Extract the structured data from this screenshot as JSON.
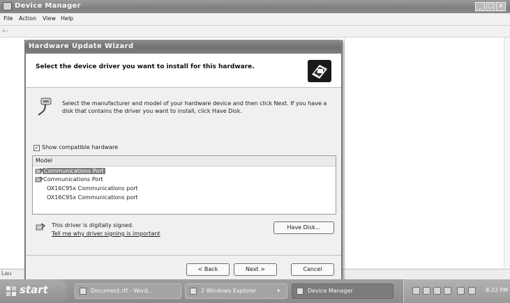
{
  "device_manager": {
    "title": "Device Manager",
    "menu": {
      "file": "File",
      "action": "Action",
      "view": "View",
      "help": "Help"
    },
    "status_text": "Lau"
  },
  "wizard": {
    "title": "Hardware Update Wizard",
    "heading": "Select the device driver you want to install for this hardware.",
    "instructions": "Select the manufacturer and model of your hardware device and then click Next. If you have a disk that contains the driver you want to install, click Have Disk.",
    "show_compatible": {
      "label": "Show compatible hardware",
      "checked": true,
      "mark": "✓"
    },
    "model_list": {
      "header": "Model",
      "items": [
        "Communications Port",
        "Communications Port",
        "OX16C95x Communications port",
        "OX16C95x Communications port"
      ],
      "selected_index": 0
    },
    "signed_text": "This driver is digitally signed.",
    "signing_link": "Tell me why driver signing is important",
    "buttons": {
      "have_disk": "Have Disk...",
      "back": "< Back",
      "next": "Next >",
      "cancel": "Cancel"
    }
  },
  "taskbar": {
    "start_label": "start",
    "tasks": [
      {
        "label": "Document.rtf - Word...",
        "icon": "word-doc-icon"
      },
      {
        "label": "2 Windows Explorer",
        "icon": "folder-icon"
      },
      {
        "label": "Device Manager",
        "icon": "device-manager-icon",
        "active": true
      }
    ],
    "clock": "8:22 PM"
  }
}
